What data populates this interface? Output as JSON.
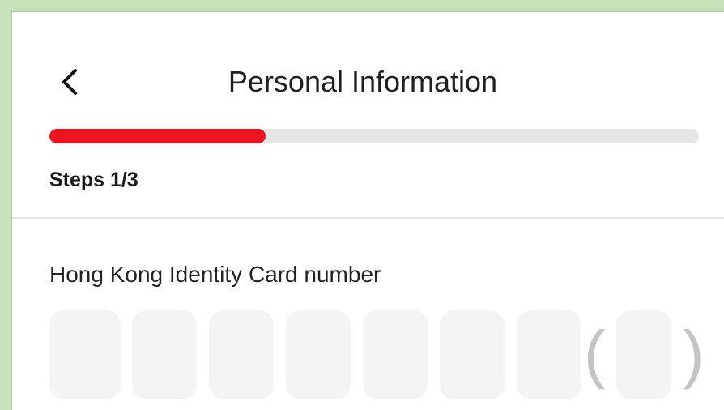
{
  "header": {
    "title": "Personal Information",
    "back_icon": "chevron-left-icon"
  },
  "progress": {
    "fraction": 0.3333,
    "steps_label": "Steps 1/3",
    "fill_color": "#e8141f",
    "track_color": "#e5e5e5"
  },
  "form": {
    "hkid_label": "Hong Kong Identity Card number",
    "hkid_digits": [
      "",
      "",
      "",
      "",
      "",
      "",
      ""
    ],
    "hkid_check_digit": "",
    "open_paren": "(",
    "close_paren": ")"
  }
}
